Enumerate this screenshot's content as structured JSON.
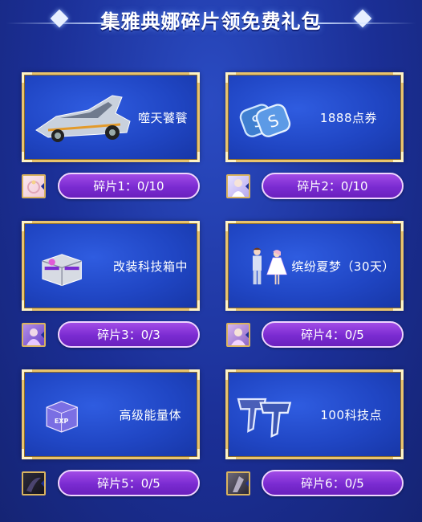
{
  "header": {
    "title": "集雅典娜碎片领免费礼包"
  },
  "colors": {
    "card_border": "#e8c36d",
    "card_bg": "#2046c4",
    "button_bg": "#7a2bd1",
    "page_bg": "#1b2f96"
  },
  "rewards": [
    {
      "name": "噬天饕餮",
      "icon": "race-car-icon",
      "fragment_label": "碎片1：0/10",
      "thumb": "jewelry-thumb-icon"
    },
    {
      "name": "1888点券",
      "icon": "coupon-coins-icon",
      "fragment_label": "碎片2：0/10",
      "thumb": "character-thumb-icon"
    },
    {
      "name": "改装科技箱中",
      "icon": "tech-chest-icon",
      "fragment_label": "碎片3：0/3",
      "thumb": "character-thumb-icon"
    },
    {
      "name": "缤纷夏梦（30天）",
      "icon": "couple-outfit-icon",
      "fragment_label": "碎片4：0/5",
      "thumb": "character-thumb-icon"
    },
    {
      "name": "高级能量体",
      "icon": "exp-cube-icon",
      "fragment_label": "碎片5：0/5",
      "thumb": "dark-thumb-icon"
    },
    {
      "name": "100科技点",
      "icon": "tech-points-icon",
      "fragment_label": "碎片6：0/5",
      "thumb": "dark-thumb-icon"
    }
  ]
}
